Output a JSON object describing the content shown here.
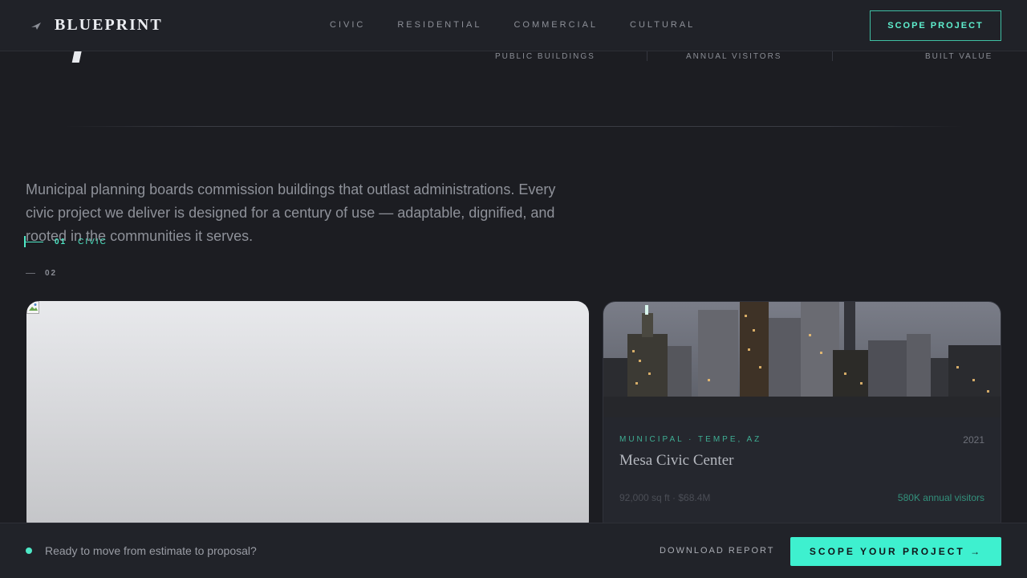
{
  "brand": {
    "name": "BLUEPRINT",
    "icon": "paper-plane-icon"
  },
  "nav": {
    "items": [
      {
        "label": "CIVIC"
      },
      {
        "label": "RESIDENTIAL"
      },
      {
        "label": "COMMERCIAL"
      },
      {
        "label": "CULTURAL"
      }
    ]
  },
  "header": {
    "cta_label": "SCOPE PROJECT"
  },
  "stats": {
    "labels": [
      "PUBLIC BUILDINGS",
      "ANNUAL VISITORS",
      "BUILT VALUE"
    ]
  },
  "intro": {
    "text": "Municipal planning boards commission buildings that outlast administrations. Every civic project we deliver is designed for a century of use — adaptable, dignified, and rooted in the communities it serves."
  },
  "sections": {
    "active": {
      "number": "01",
      "label": "CIVIC"
    },
    "next": {
      "number": "02"
    }
  },
  "project_card": {
    "meta": "MUNICIPAL · TEMPE, AZ",
    "year": "2021",
    "title": "Mesa Civic Center",
    "specs": "92,000 sq ft · $68.4M",
    "visitors": "580K annual visitors"
  },
  "bottom_bar": {
    "prompt": "Ready to move from estimate to proposal?",
    "download_label": "DOWNLOAD REPORT",
    "cta_label": "SCOPE YOUR PROJECT →"
  },
  "colors": {
    "accent": "#3ef0cf",
    "background": "#1c1d22",
    "surface": "#25272e"
  }
}
